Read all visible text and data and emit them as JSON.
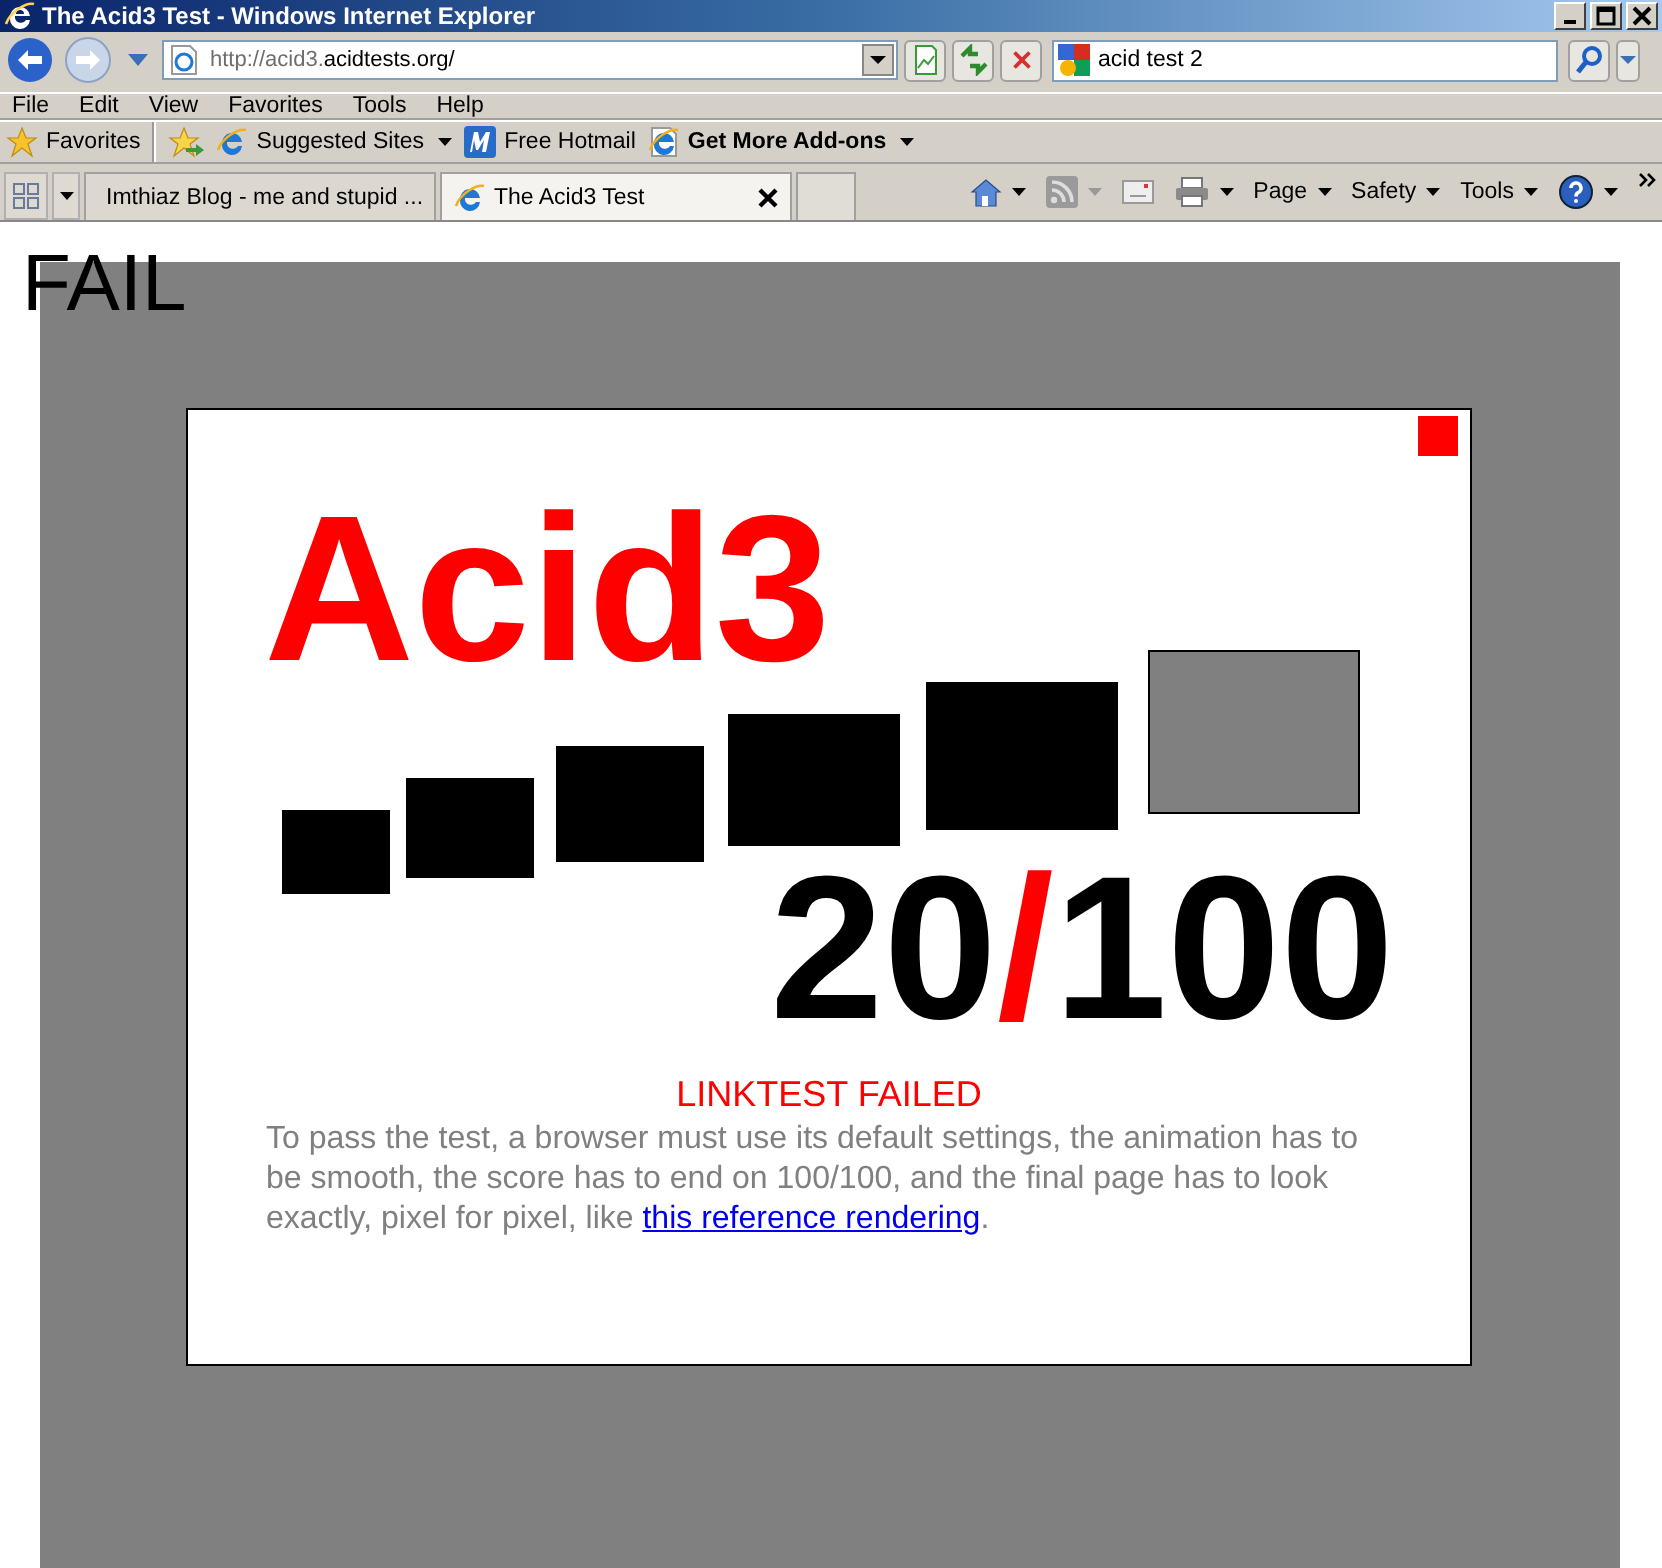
{
  "window": {
    "title": "The Acid3 Test - Windows Internet Explorer"
  },
  "address_bar": {
    "url_prefix": "http://acid3.",
    "url_domain": "acidtests.org/"
  },
  "search": {
    "value": "acid test 2"
  },
  "menu": [
    "File",
    "Edit",
    "View",
    "Favorites",
    "Tools",
    "Help"
  ],
  "favorites_bar": {
    "label": "Favorites",
    "links": [
      {
        "label": "Suggested Sites",
        "dropdown": true,
        "emphasized": false
      },
      {
        "label": "Free Hotmail",
        "dropdown": false,
        "emphasized": false
      },
      {
        "label": "Get More Add-ons",
        "dropdown": true,
        "emphasized": true
      }
    ]
  },
  "tabs": [
    {
      "label": "Imthiaz Blog - me and stupid ...",
      "selected": false
    },
    {
      "label": "The Acid3 Test",
      "selected": true
    }
  ],
  "command_bar": [
    "Page",
    "Safety",
    "Tools"
  ],
  "page": {
    "status": "FAIL",
    "heading": "Acid3",
    "buckets": [
      {
        "color": "#000000"
      },
      {
        "color": "#000000"
      },
      {
        "color": "#000000"
      },
      {
        "color": "#000000"
      },
      {
        "color": "#000000"
      },
      {
        "color": "#808080"
      }
    ],
    "score": {
      "passed": "20",
      "slash": "/",
      "total": "100"
    },
    "message": "LINKTEST FAILED",
    "text": "To pass the test, a browser must use its default settings, the animation has to be smooth, the score has to end on 100/100, and the final page has to look exactly, pixel for pixel, like ",
    "link": "this reference rendering",
    "text_end": "."
  }
}
